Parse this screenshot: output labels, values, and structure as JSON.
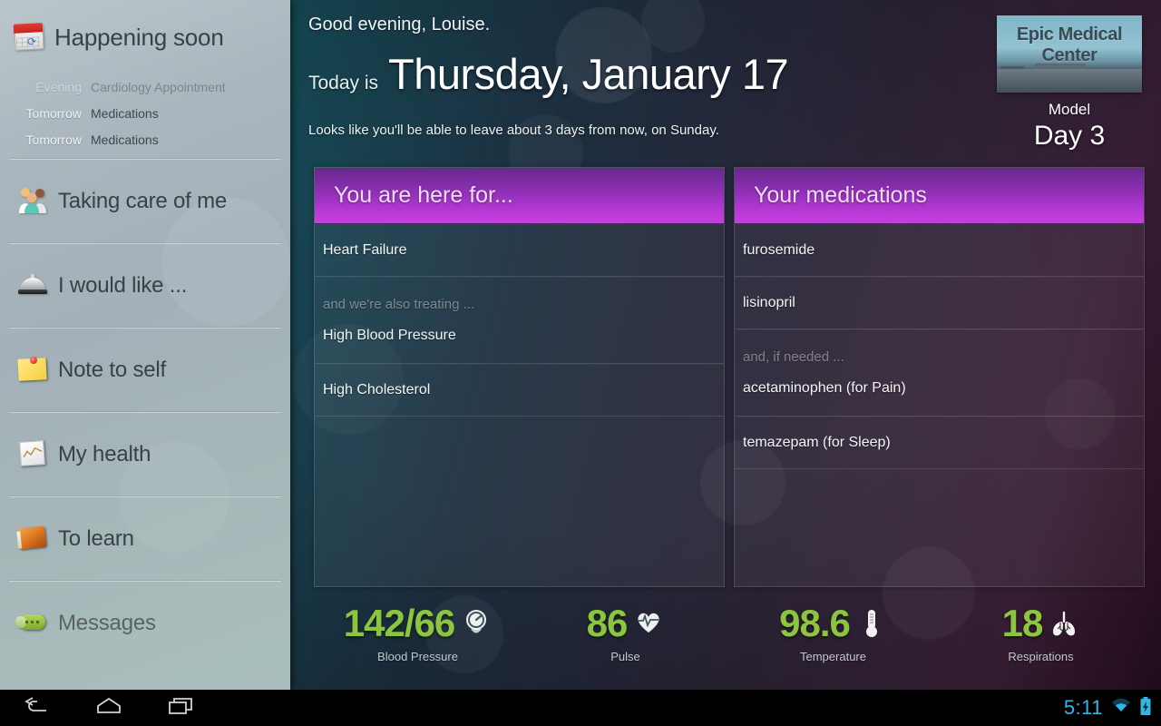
{
  "sidebar": {
    "header": {
      "title": "Happening soon",
      "icon": "calendar-icon"
    },
    "appointments": [
      {
        "when": "Evening",
        "what": "Cardiology Appointment",
        "dim": true
      },
      {
        "when": "Tomorrow",
        "what": "Medications",
        "dim": false
      },
      {
        "when": "Tomorrow",
        "what": "Medications",
        "dim": false
      }
    ],
    "items": [
      {
        "label": "Taking care of me",
        "icon": "people-icon"
      },
      {
        "label": "I would like ...",
        "icon": "service-bell-icon"
      },
      {
        "label": "Note to self",
        "icon": "sticky-note-icon"
      },
      {
        "label": "My health",
        "icon": "chart-page-icon"
      },
      {
        "label": "To learn",
        "icon": "book-icon"
      },
      {
        "label": "Messages",
        "icon": "message-bubble-icon"
      }
    ]
  },
  "header": {
    "greeting": "Good evening, Louise.",
    "today_label": "Today is",
    "today_date": "Thursday, January 17",
    "discharge_note": "Looks like you'll be able to leave about 3 days from now, on Sunday.",
    "logo_text": "Epic Medical Center",
    "model_label": "Model",
    "day_label": "Day 3"
  },
  "cards": [
    {
      "title": "You are here for...",
      "primary": "Heart Failure",
      "group_note": "and we're also treating ...",
      "group_first": "High Blood Pressure",
      "extra": "High Cholesterol"
    },
    {
      "title": "Your medications",
      "primary": "furosemide",
      "second": "lisinopril",
      "group_note": "and, if needed ...",
      "group_first": "acetaminophen (for Pain)",
      "extra": "temazepam (for Sleep)"
    }
  ],
  "vitals": [
    {
      "value": "142/66",
      "label": "Blood Pressure",
      "icon": "blood-pressure-gauge-icon"
    },
    {
      "value": "86",
      "label": "Pulse",
      "icon": "heart-pulse-icon"
    },
    {
      "value": "98.6",
      "label": "Temperature",
      "icon": "thermometer-icon"
    },
    {
      "value": "18",
      "label": "Respirations",
      "icon": "lungs-icon"
    }
  ],
  "navbar": {
    "back": "back-icon",
    "home": "home-icon",
    "recents": "recents-icon",
    "clock": "5:11",
    "wifi": "wifi-icon",
    "battery": "battery-charging-icon"
  },
  "colors": {
    "accent_purple": "#b739d6",
    "vital_green": "#8cc63e",
    "clock_blue": "#33b5e5"
  }
}
